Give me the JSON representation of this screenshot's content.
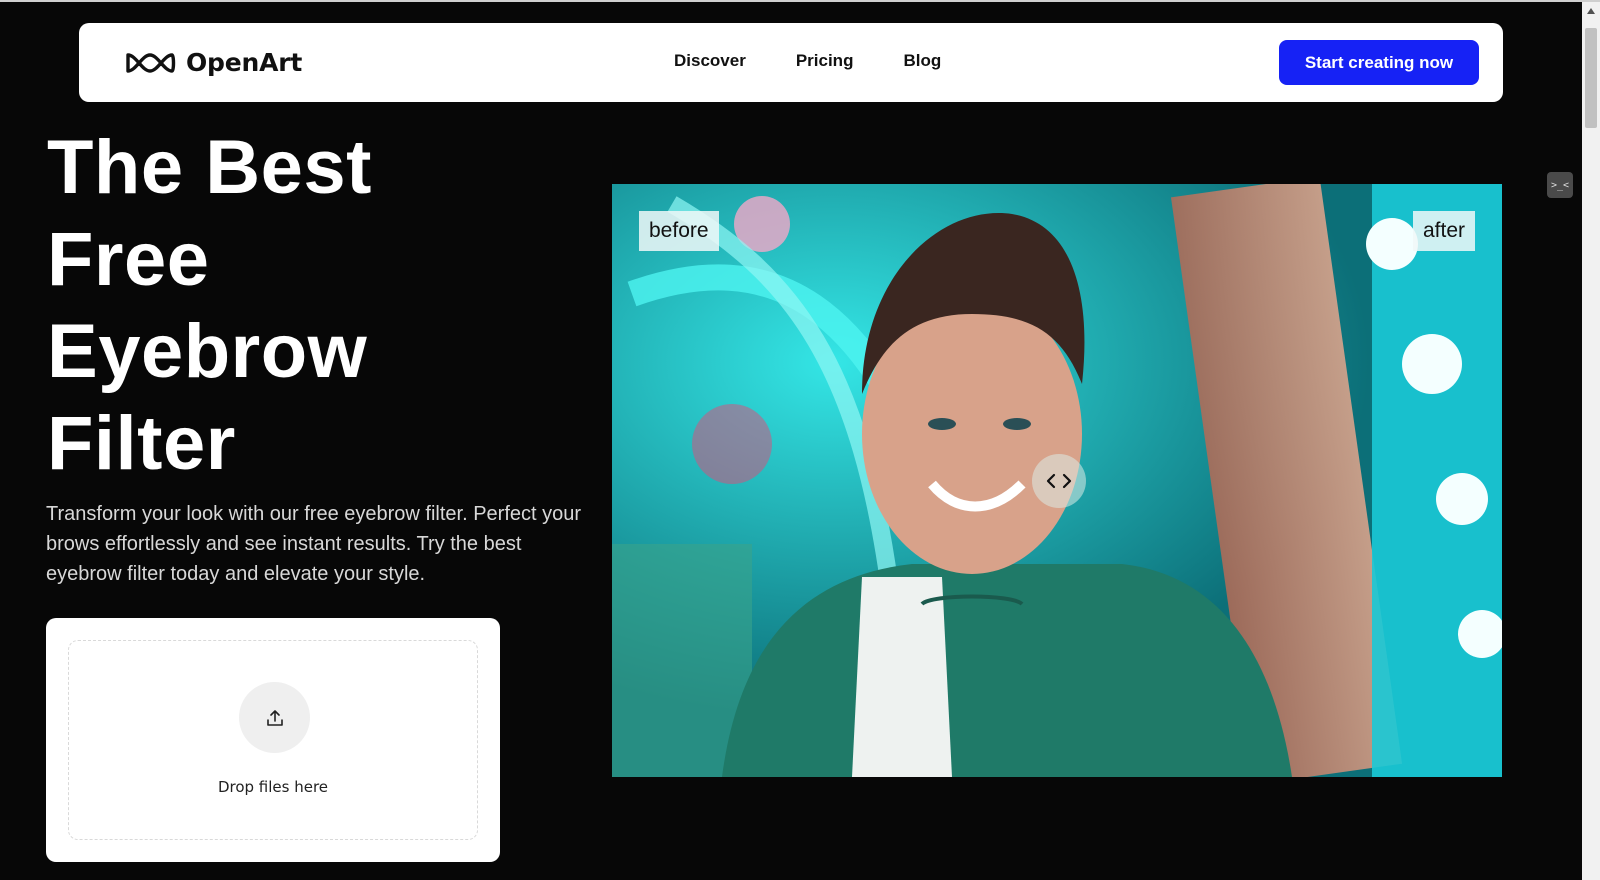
{
  "header": {
    "logo_text": "OpenArt",
    "nav": [
      {
        "label": "Discover"
      },
      {
        "label": "Pricing"
      },
      {
        "label": "Blog"
      }
    ],
    "cta_label": "Start creating now"
  },
  "hero": {
    "title_lines": [
      "The Best",
      "Free",
      "Eyebrow",
      "Filter"
    ],
    "description": "Transform your look with our free eyebrow filter. Perfect your brows effortlessly and see instant results. Try the best eyebrow filter today and elevate your style."
  },
  "upload": {
    "drop_label": "Drop files here",
    "icon": "upload-icon"
  },
  "comparison": {
    "before_label": "before",
    "after_label": "after",
    "handle_icon": "chevron-left-right-icon"
  },
  "extension_widget": {
    "text": ">_<"
  },
  "colors": {
    "background": "#070707",
    "accent": "#1622f5",
    "card": "#ffffff"
  }
}
